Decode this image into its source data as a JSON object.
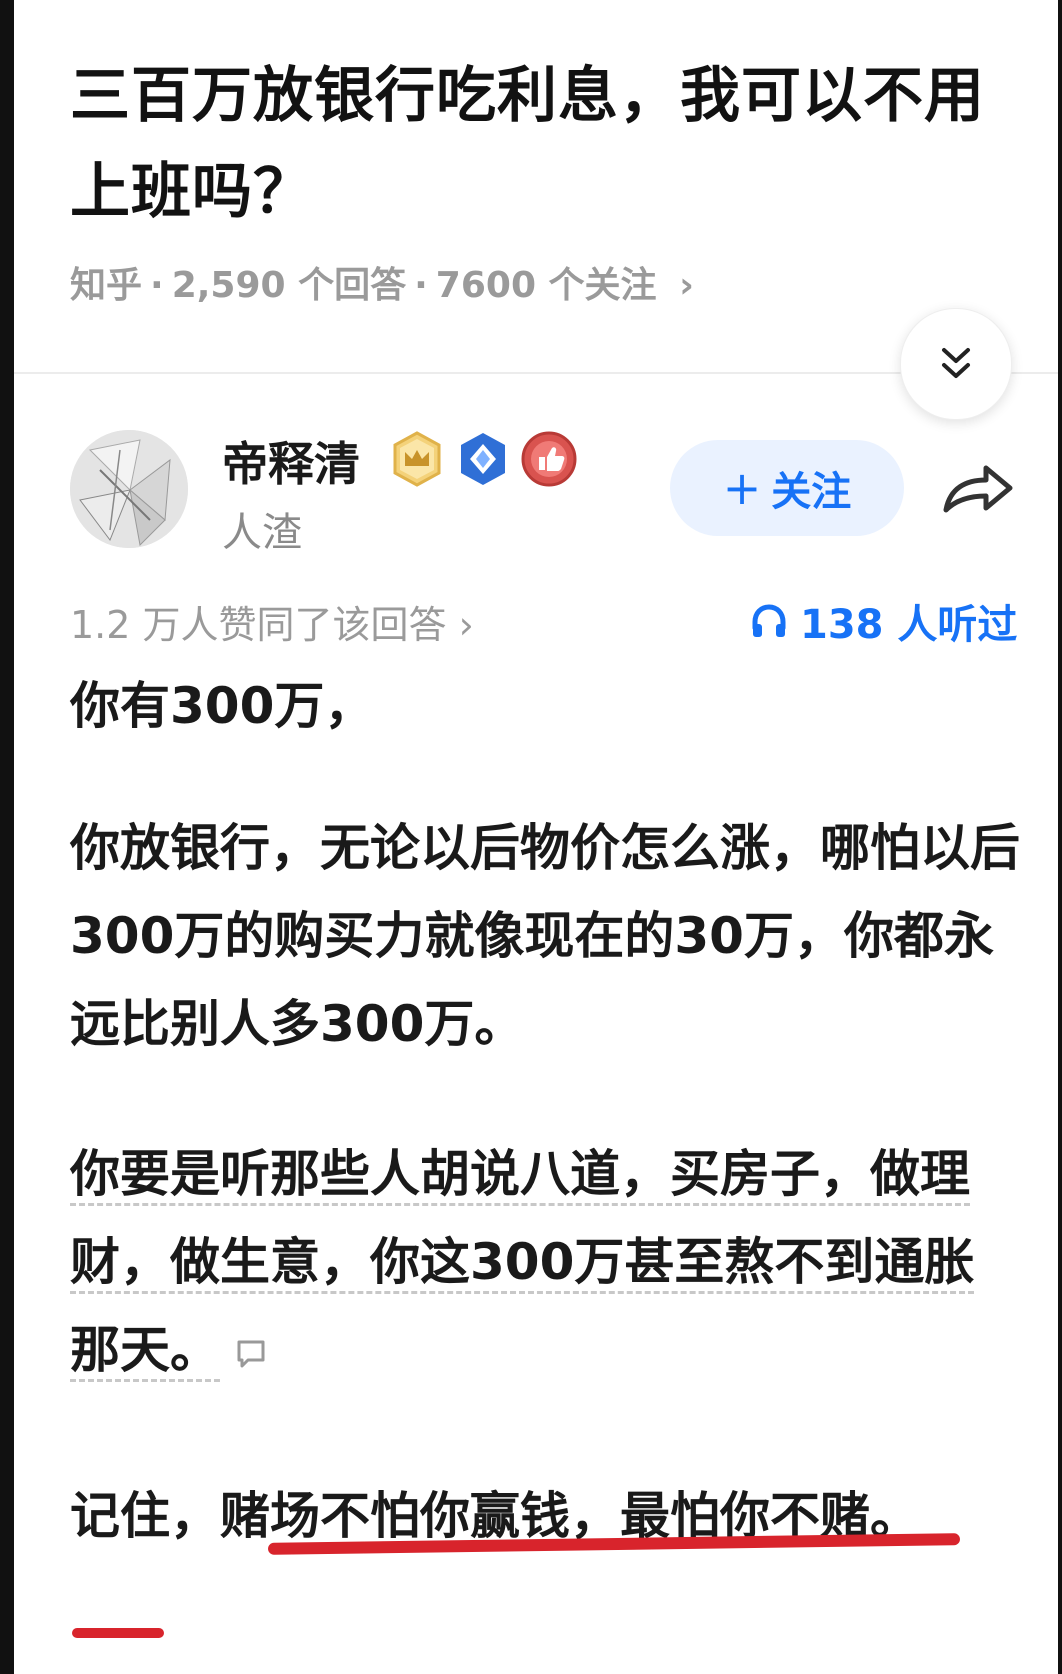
{
  "question": {
    "title": "三百万放银行吃利息，我可以不用上班吗？",
    "source": "知乎",
    "answers": "2,590 个回答",
    "followers": "7600 个关注",
    "chevron": "›"
  },
  "author": {
    "name": "帝释清",
    "bio": "人渣",
    "follow_label": "关注",
    "follow_plus": "+"
  },
  "stats": {
    "agree_text": "1.2 万人赞同了该回答 ›",
    "listen_text": "138 人听过"
  },
  "answer": {
    "p1": "你有300万，",
    "p2": "你放银行，无论以后物价怎么涨，哪怕以后300万的购买力就像现在的30万，你都永远比别人多300万。",
    "p3": "你要是听那些人胡说八道，买房子，做理财，做生意，你这300万甚至熬不到通胀那天。",
    "p4": "记住，赌场不怕你赢钱，最怕你不赌。"
  },
  "icons": {
    "collapse": "double-chevron-down-icon",
    "share": "share-arrow-icon",
    "headphone": "headphone-icon",
    "comment": "comment-bubble-icon",
    "badges": [
      "crown-badge-icon",
      "diamond-badge-icon",
      "thumb-badge-icon"
    ]
  },
  "colors": {
    "accent": "#1772f6",
    "highlight_underline": "#d8242c",
    "meta_gray": "#9a9a9a"
  }
}
